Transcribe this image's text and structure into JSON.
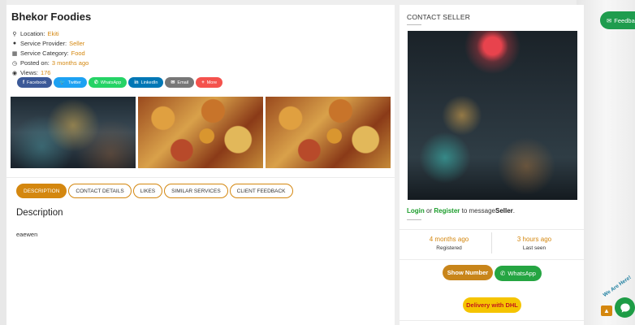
{
  "listing": {
    "title": "Bhekor Foodies",
    "location_label": "Location:",
    "location_value": "Ekiti",
    "provider_label": "Service Provider:",
    "provider_value": "Seller",
    "category_label": "Service Category:",
    "category_value": "Food",
    "posted_label": "Posted on:",
    "posted_value": "3 months ago",
    "views_label": "Views:",
    "views_value": "176"
  },
  "share": [
    {
      "label": "Facebook",
      "icon": "facebook-icon",
      "glyph": "f",
      "color": "#3b5998"
    },
    {
      "label": "Twitter",
      "icon": "twitter-icon",
      "glyph": "🐦",
      "color": "#1da1f2"
    },
    {
      "label": "WhatsApp",
      "icon": "whatsapp-icon",
      "glyph": "✆",
      "color": "#25d366"
    },
    {
      "label": "LinkedIn",
      "icon": "linkedin-icon",
      "glyph": "in",
      "color": "#0077b5"
    },
    {
      "label": "Email",
      "icon": "email-icon",
      "glyph": "✉",
      "color": "#777777"
    },
    {
      "label": "More",
      "icon": "plus-icon",
      "glyph": "+",
      "color": "#f4524d"
    }
  ],
  "tabs": [
    {
      "label": "DESCRIPTION",
      "active": true
    },
    {
      "label": "CONTACT DETAILS",
      "active": false
    },
    {
      "label": "LIKES",
      "active": false
    },
    {
      "label": "SIMILAR SERVICES",
      "active": false
    },
    {
      "label": "CLIENT FEEDBACK",
      "active": false
    }
  ],
  "description": {
    "heading": "Description",
    "text": "eaewen"
  },
  "contact": {
    "title": "CONTACT SELLER",
    "login": "Login",
    "or": "or",
    "register": "Register",
    "to_message": "to message",
    "seller": "Seller",
    "period": ".",
    "registered_value": "4 months ago",
    "registered_label": "Registered",
    "lastseen_value": "3 hours ago",
    "lastseen_label": "Last seen",
    "show_number": "Show Number",
    "whatsapp": "WhatsApp",
    "dhl": "Delivery with DHL"
  },
  "widgets": {
    "feedback": "Feedback",
    "chat_badge": "We Are Here!",
    "scroll_top_glyph": "▲"
  },
  "colors": {
    "accent": "#d4870f",
    "green": "#25a542",
    "dhl_yellow": "#f5c400"
  }
}
